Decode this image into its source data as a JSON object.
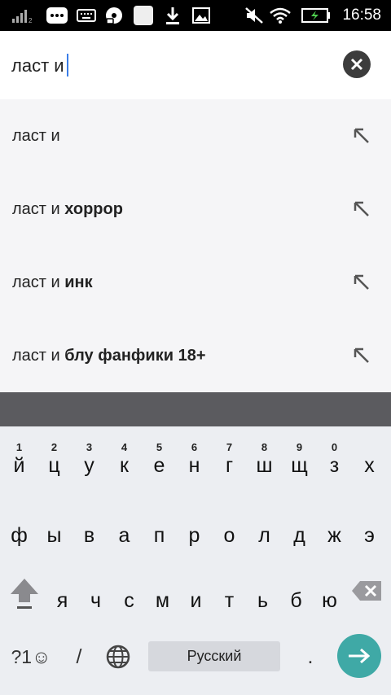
{
  "status_bar": {
    "time": "16:58",
    "icons": [
      "signal-icon",
      "keyboard-notification-icon",
      "keyboard-icon",
      "disc-icon",
      "app-icon",
      "download-icon",
      "image-icon",
      "mute-icon",
      "wifi-icon",
      "battery-charging-icon"
    ]
  },
  "search": {
    "query": "ласт и"
  },
  "suggestions": [
    {
      "prefix": "ласт и",
      "completion": ""
    },
    {
      "prefix": "ласт и",
      "completion": "хоррор"
    },
    {
      "prefix": "ласт и",
      "completion": "инк"
    },
    {
      "prefix": "ласт и",
      "completion": "блу фанфики 18+"
    }
  ],
  "keyboard": {
    "row1": [
      "й",
      "ц",
      "у",
      "к",
      "е",
      "н",
      "г",
      "ш",
      "щ",
      "з",
      "х"
    ],
    "row1_hints": [
      "1",
      "2",
      "3",
      "4",
      "5",
      "6",
      "7",
      "8",
      "9",
      "0",
      ""
    ],
    "row2": [
      "ф",
      "ы",
      "в",
      "а",
      "п",
      "р",
      "о",
      "л",
      "д",
      "ж",
      "э"
    ],
    "row3": [
      "я",
      "ч",
      "с",
      "м",
      "и",
      "т",
      "ь",
      "б",
      "ю"
    ],
    "symbols_label": "?1☺",
    "slash_label": "/",
    "space_label": "Русский",
    "period_label": "."
  }
}
